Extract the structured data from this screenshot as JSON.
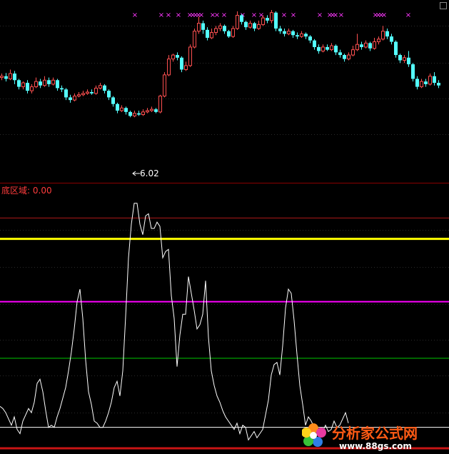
{
  "indicator": {
    "name": "底区域",
    "value_text": "0.00"
  },
  "price_panel": {
    "low_label": "6.02"
  },
  "signal_glyph": "×",
  "watermark": {
    "brand": "分析家公式网",
    "url": "www.88gs.com"
  },
  "colors": {
    "background": "#000000",
    "candle_up": "#ff5050",
    "candle_down": "#54ffff",
    "signal": "#ff38ff",
    "line_top_red": "#b01818",
    "line_yellow": "#ffff00",
    "line_magenta": "#ff00ff",
    "line_green": "#00c800",
    "line_white": "#ffffff",
    "line_bottom_red": "#c81414",
    "indicator_curve": "#ffffff"
  },
  "chart_data": {
    "type": "line",
    "indicator_levels": [
      100,
      90,
      60,
      33,
      0,
      -10
    ],
    "indicator_ylim": [
      -10,
      110
    ],
    "indicator_x": [
      0,
      4,
      8,
      12,
      16,
      20,
      24,
      28,
      32,
      36,
      40,
      44,
      48,
      52,
      56,
      60,
      64,
      68,
      72,
      76,
      80,
      84,
      88,
      92,
      96,
      100,
      104,
      108,
      112,
      116,
      120,
      124,
      128,
      132,
      136,
      140,
      144,
      148,
      152,
      156,
      160,
      164,
      168,
      172,
      176,
      180,
      184,
      188,
      192,
      196,
      200,
      204,
      208,
      212,
      216,
      220,
      224,
      228,
      232,
      236,
      240,
      244,
      248,
      252,
      256,
      260,
      264,
      268,
      272,
      276,
      280,
      284,
      288,
      292,
      296,
      300,
      304,
      308,
      312,
      316,
      320,
      324,
      328,
      332,
      336,
      340,
      344,
      348,
      352,
      356,
      360,
      364,
      368,
      372,
      376,
      380,
      384,
      388,
      392,
      396,
      400,
      404,
      408,
      412,
      416,
      420,
      424,
      428,
      432,
      436,
      440,
      444,
      448,
      452,
      456,
      460,
      464,
      468,
      472,
      476,
      480,
      484,
      488,
      492,
      496,
      500,
      504,
      508,
      512,
      516,
      520,
      524,
      528,
      532,
      536,
      540,
      544,
      548,
      552,
      556,
      560,
      564,
      568,
      572,
      576,
      580,
      584,
      588,
      592,
      596,
      600,
      604,
      608,
      612
    ],
    "indicator_values": [
      10,
      9,
      7,
      4,
      1,
      5,
      -1,
      -3,
      3,
      6,
      9,
      7,
      12,
      21,
      23,
      17,
      8,
      0,
      1,
      0,
      5,
      9,
      14,
      19,
      27,
      36,
      47,
      60,
      66,
      52,
      32,
      17,
      11,
      3,
      2,
      0,
      0,
      3,
      7,
      12,
      19,
      22,
      15,
      27,
      53,
      81,
      97,
      107,
      107,
      97,
      92,
      101,
      102,
      95,
      95,
      98,
      96,
      81,
      84,
      85,
      63,
      52,
      29,
      44,
      54,
      54,
      72,
      64,
      56,
      47,
      49,
      54,
      70,
      43,
      27,
      20,
      15,
      12,
      8,
      5,
      3,
      1,
      -1,
      2,
      -3,
      1,
      0,
      -6,
      -4,
      -2,
      -5,
      -3,
      -1,
      6,
      13,
      25,
      30,
      31,
      25,
      39,
      57,
      66,
      64,
      51,
      35,
      20,
      11,
      1,
      5,
      3,
      0,
      -1,
      -2,
      -2,
      1,
      -2,
      -1,
      3,
      0,
      1,
      4,
      7,
      2
    ],
    "price_ylim": [
      5.8,
      12.0
    ],
    "price_candles_note": "OHLC estimated from screenshot",
    "price_candles": [
      [
        0,
        9.45,
        9.5,
        9.6,
        9.35
      ],
      [
        6,
        9.5,
        9.4,
        9.62,
        9.3
      ],
      [
        12,
        9.4,
        9.6,
        9.75,
        9.35
      ],
      [
        18,
        9.6,
        9.35,
        9.7,
        9.2
      ],
      [
        24,
        9.35,
        9.1,
        9.4,
        9.0
      ],
      [
        30,
        9.1,
        9.25,
        9.3,
        9.0
      ],
      [
        36,
        9.25,
        8.95,
        9.35,
        8.85
      ],
      [
        42,
        8.95,
        9.1,
        9.2,
        8.85
      ],
      [
        48,
        9.1,
        9.3,
        9.45,
        9.05
      ],
      [
        54,
        9.3,
        9.15,
        9.4,
        9.05
      ],
      [
        60,
        9.15,
        9.35,
        9.5,
        9.1
      ],
      [
        66,
        9.35,
        9.2,
        9.45,
        9.1
      ],
      [
        72,
        9.2,
        9.35,
        9.45,
        9.15
      ],
      [
        78,
        9.35,
        9.05,
        9.4,
        8.95
      ],
      [
        84,
        9.05,
        9.0,
        9.15,
        8.9
      ],
      [
        90,
        9.0,
        8.7,
        9.05,
        8.6
      ],
      [
        96,
        8.7,
        8.6,
        8.8,
        8.5
      ],
      [
        102,
        8.6,
        8.75,
        8.85,
        8.55
      ],
      [
        108,
        8.75,
        8.8,
        8.9,
        8.7
      ],
      [
        114,
        8.8,
        8.85,
        8.95,
        8.75
      ],
      [
        120,
        8.85,
        8.9,
        9.0,
        8.8
      ],
      [
        126,
        8.9,
        8.85,
        9.0,
        8.8
      ],
      [
        132,
        8.85,
        9.05,
        9.15,
        8.8
      ],
      [
        138,
        9.05,
        9.15,
        9.25,
        9.0
      ],
      [
        144,
        9.15,
        8.95,
        9.2,
        8.85
      ],
      [
        150,
        8.95,
        8.7,
        9.0,
        8.6
      ],
      [
        156,
        8.7,
        8.45,
        8.75,
        8.35
      ],
      [
        162,
        8.45,
        8.2,
        8.5,
        8.1
      ],
      [
        168,
        8.2,
        8.3,
        8.4,
        8.15
      ],
      [
        174,
        8.3,
        8.15,
        8.35,
        8.05
      ],
      [
        180,
        8.15,
        8.0,
        8.2,
        7.95
      ],
      [
        186,
        8.0,
        8.1,
        8.2,
        7.95
      ],
      [
        192,
        8.1,
        8.05,
        8.2,
        8.0
      ],
      [
        198,
        8.05,
        8.15,
        8.25,
        8.0
      ],
      [
        204,
        8.15,
        8.2,
        8.3,
        8.1
      ],
      [
        210,
        8.2,
        8.25,
        8.35,
        8.15
      ],
      [
        216,
        8.25,
        8.15,
        8.3,
        8.1
      ],
      [
        222,
        8.15,
        8.75,
        8.8,
        8.1
      ],
      [
        228,
        8.75,
        9.55,
        9.65,
        8.7
      ],
      [
        234,
        9.55,
        10.15,
        10.3,
        9.5
      ],
      [
        240,
        10.15,
        10.3,
        10.35,
        10.05
      ],
      [
        246,
        10.3,
        10.2,
        10.4,
        10.1
      ],
      [
        252,
        10.2,
        9.75,
        10.25,
        9.65
      ],
      [
        258,
        9.75,
        9.9,
        10.05,
        9.7
      ],
      [
        264,
        9.9,
        10.6,
        10.7,
        9.85
      ],
      [
        270,
        10.6,
        11.2,
        11.3,
        10.55
      ],
      [
        276,
        11.2,
        11.5,
        11.75,
        11.1
      ],
      [
        282,
        11.5,
        11.25,
        11.6,
        11.1
      ],
      [
        288,
        11.25,
        10.95,
        11.35,
        10.85
      ],
      [
        294,
        10.95,
        11.15,
        11.3,
        10.9
      ],
      [
        300,
        11.15,
        11.3,
        11.4,
        11.05
      ],
      [
        306,
        11.3,
        11.4,
        11.5,
        11.2
      ],
      [
        312,
        11.4,
        11.2,
        11.45,
        11.1
      ],
      [
        318,
        11.2,
        11.0,
        11.25,
        10.95
      ],
      [
        324,
        11.0,
        11.3,
        11.4,
        10.95
      ],
      [
        330,
        11.3,
        11.8,
        11.95,
        11.25
      ],
      [
        336,
        11.8,
        11.55,
        11.85,
        11.45
      ],
      [
        342,
        11.55,
        11.35,
        11.6,
        11.25
      ],
      [
        348,
        11.35,
        11.5,
        11.6,
        11.3
      ],
      [
        354,
        11.5,
        11.3,
        11.55,
        11.2
      ],
      [
        360,
        11.3,
        11.45,
        11.6,
        11.25
      ],
      [
        366,
        11.45,
        11.7,
        11.8,
        11.4
      ],
      [
        372,
        11.7,
        11.6,
        11.8,
        11.5
      ],
      [
        378,
        11.6,
        11.9,
        12.0,
        11.5
      ],
      [
        384,
        11.9,
        11.3,
        11.95,
        11.2
      ],
      [
        390,
        11.3,
        11.2,
        11.4,
        11.1
      ],
      [
        396,
        11.2,
        11.1,
        11.3,
        11.0
      ],
      [
        402,
        11.1,
        11.2,
        11.3,
        11.05
      ],
      [
        408,
        11.2,
        11.05,
        11.25,
        10.95
      ],
      [
        414,
        11.05,
        11.0,
        11.15,
        10.9
      ],
      [
        420,
        11.0,
        11.1,
        11.2,
        10.95
      ],
      [
        426,
        11.1,
        11.0,
        11.15,
        10.9
      ],
      [
        432,
        11.0,
        10.85,
        11.05,
        10.75
      ],
      [
        438,
        10.85,
        10.6,
        10.9,
        10.5
      ],
      [
        444,
        10.6,
        10.45,
        10.7,
        10.35
      ],
      [
        450,
        10.45,
        10.6,
        10.7,
        10.4
      ],
      [
        456,
        10.6,
        10.5,
        10.7,
        10.45
      ],
      [
        462,
        10.5,
        10.65,
        10.75,
        10.45
      ],
      [
        468,
        10.65,
        10.4,
        10.7,
        10.3
      ],
      [
        474,
        10.4,
        10.3,
        10.5,
        10.2
      ],
      [
        480,
        10.3,
        10.15,
        10.35,
        10.05
      ],
      [
        486,
        10.15,
        10.3,
        10.4,
        10.1
      ],
      [
        492,
        10.3,
        10.5,
        10.65,
        10.25
      ],
      [
        498,
        10.5,
        10.7,
        11.1,
        10.45
      ],
      [
        504,
        10.7,
        10.6,
        10.8,
        10.5
      ],
      [
        510,
        10.6,
        10.75,
        10.85,
        10.55
      ],
      [
        516,
        10.75,
        10.55,
        10.8,
        10.45
      ],
      [
        522,
        10.55,
        10.8,
        10.95,
        10.5
      ],
      [
        528,
        10.8,
        10.9,
        11.0,
        10.7
      ],
      [
        534,
        10.9,
        11.2,
        11.4,
        10.85
      ],
      [
        540,
        11.2,
        11.0,
        11.3,
        10.9
      ],
      [
        546,
        11.0,
        10.8,
        11.1,
        10.7
      ],
      [
        552,
        10.8,
        10.3,
        10.85,
        10.2
      ],
      [
        558,
        10.3,
        10.1,
        10.35,
        10.0
      ],
      [
        564,
        10.1,
        10.2,
        10.3,
        10.0
      ],
      [
        570,
        10.2,
        9.95,
        10.45,
        9.85
      ],
      [
        576,
        9.95,
        9.4,
        10.0,
        9.3
      ],
      [
        582,
        9.4,
        9.1,
        9.5,
        9.0
      ],
      [
        588,
        9.1,
        9.3,
        9.4,
        9.05
      ],
      [
        594,
        9.3,
        9.2,
        9.4,
        9.1
      ],
      [
        600,
        9.2,
        9.5,
        9.6,
        9.15
      ],
      [
        606,
        9.5,
        9.25,
        9.65,
        9.15
      ],
      [
        612,
        9.25,
        9.15,
        9.35,
        9.05
      ]
    ],
    "price_signals_x": [
      189,
      226,
      236,
      250,
      266,
      270,
      274,
      278,
      282,
      298,
      304,
      314,
      340,
      356,
      366,
      398,
      411,
      448,
      462,
      466,
      470,
      478,
      526,
      530,
      534,
      538,
      572
    ]
  }
}
